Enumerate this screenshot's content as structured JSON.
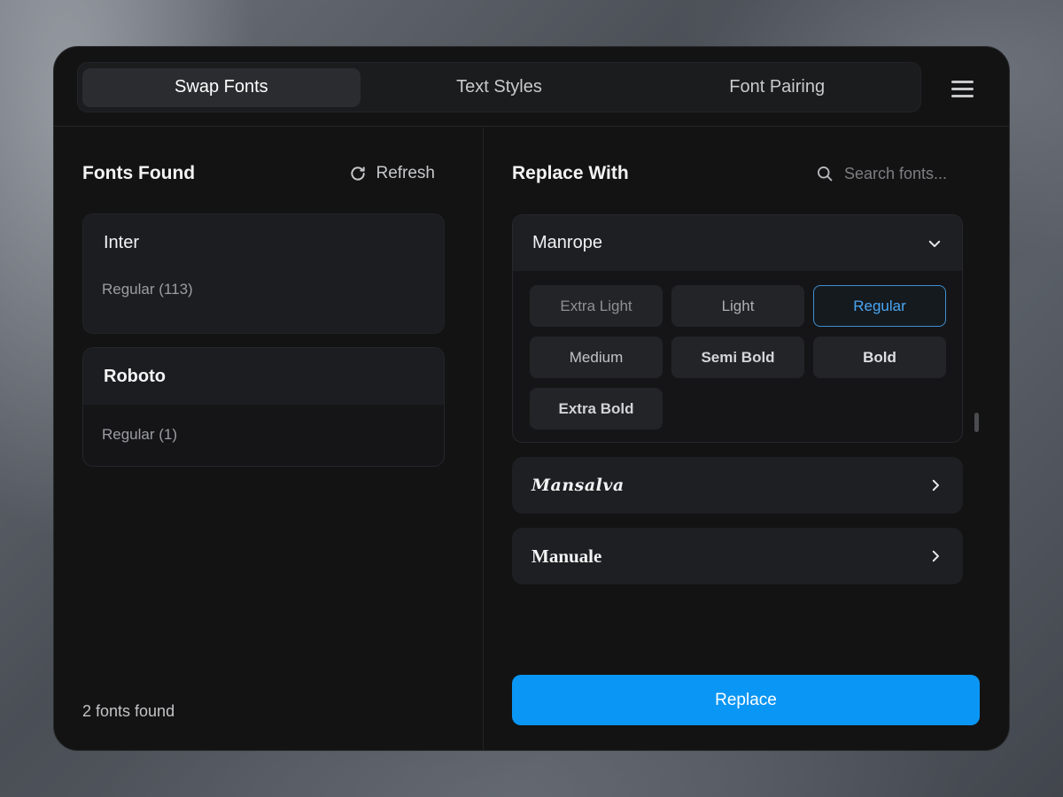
{
  "tabs": [
    {
      "label": "Swap Fonts",
      "active": true
    },
    {
      "label": "Text Styles",
      "active": false
    },
    {
      "label": "Font Pairing",
      "active": false
    }
  ],
  "menu_icon": "hamburger-menu-icon",
  "left_panel": {
    "title": "Fonts Found",
    "refresh_label": "Refresh",
    "refresh_icon": "refresh-icon",
    "fonts": [
      {
        "name": "Inter",
        "detail": "Regular (113)"
      },
      {
        "name": "Roboto",
        "detail": "Regular (1)"
      }
    ],
    "count_text": "2 fonts found"
  },
  "right_panel": {
    "title": "Replace With",
    "search_placeholder": "Search fonts...",
    "search_icon": "search-icon",
    "expanded_family": {
      "name": "Manrope",
      "icon": "chevron-down-icon",
      "weights": [
        "Extra Light",
        "Light",
        "Regular",
        "Medium",
        "Semi Bold",
        "Bold",
        "Extra Bold"
      ],
      "selected_weight": "Regular"
    },
    "families": [
      {
        "name": "Mansalva",
        "icon": "chevron-right-icon"
      },
      {
        "name": "Manuale",
        "icon": "chevron-right-icon"
      }
    ],
    "replace_label": "Replace"
  },
  "colors": {
    "accent": "#0a96f5",
    "selected_border": "#3f8fd1",
    "selected_text": "#4aa6f2",
    "window_bg": "#131314"
  }
}
